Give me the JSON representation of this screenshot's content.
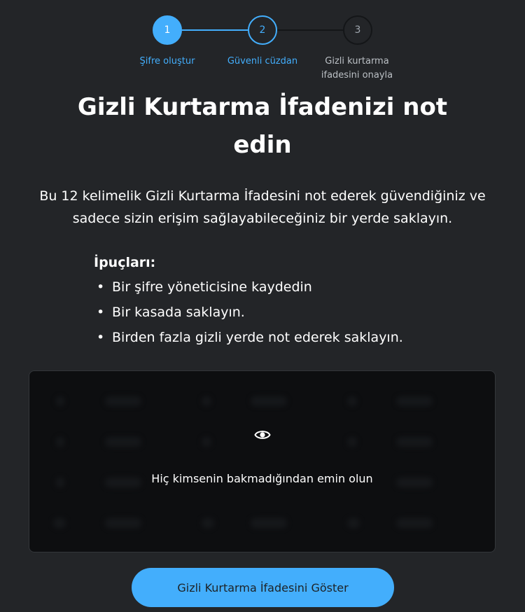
{
  "stepper": {
    "steps": [
      {
        "number": "1",
        "label": "Şifre oluştur"
      },
      {
        "number": "2",
        "label": "Güvenli cüzdan"
      },
      {
        "number": "3",
        "label": "Gizli kurtarma ifadesini onayla"
      }
    ]
  },
  "heading": {
    "title": "Gizli Kurtarma İfadenizi not edin"
  },
  "description": "Bu 12 kelimelik Gizli Kurtarma İfadesini not ederek güvendiğiniz ve sadece sizin erişim sağlayabileceğiniz bir yerde saklayın.",
  "tips": {
    "title": "İpuçları:",
    "items": [
      "Bir şifre yöneticisine kaydedin",
      "Bir kasada saklayın.",
      "Birden fazla gizli yerde not ederek saklayın."
    ]
  },
  "phrase_box": {
    "reveal_icon": "eye-icon",
    "reveal_text": "Hiç kimsenin bakmadığından emin olun"
  },
  "reveal_button": {
    "label": "Gizli Kurtarma İfadesini Göster"
  },
  "colors": {
    "background": "#232528",
    "accent": "#43aefc",
    "inactive_step": "#141618",
    "box_background": "#0d0e10"
  }
}
